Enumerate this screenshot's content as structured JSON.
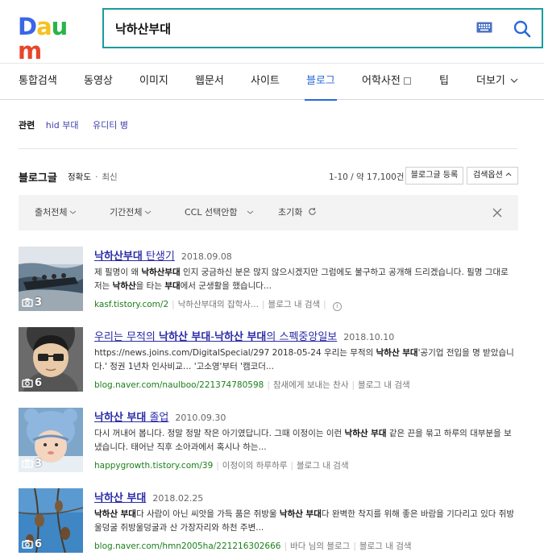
{
  "logo": {
    "text": "Daum",
    "letters": [
      "D",
      "a",
      "u",
      "m"
    ],
    "colors": [
      "#3a66e8",
      "#f5c21f",
      "#2bb34a",
      "#e8452a"
    ]
  },
  "search": {
    "query": "낙하산부대",
    "placeholder": ""
  },
  "tabs": [
    {
      "label": "통합검색"
    },
    {
      "label": "동영상"
    },
    {
      "label": "이미지"
    },
    {
      "label": "웹문서"
    },
    {
      "label": "사이트"
    },
    {
      "label": "블로그",
      "active": true
    },
    {
      "label": "어학사전"
    },
    {
      "label": "팁"
    },
    {
      "label": "더보기"
    }
  ],
  "related": {
    "label": "관련",
    "items": [
      "hid 부대",
      "유디티 병"
    ]
  },
  "blog_section": {
    "title": "블로그글",
    "sort_active": "정확도",
    "sort_other": "최신",
    "count": "1-10 / 약 17,100건",
    "register_button": "블로그글 등록",
    "options_button": "검색옵션"
  },
  "filters": [
    "출처전체",
    "기간전체",
    "CCL 선택안함",
    "초기화"
  ],
  "results": [
    {
      "title_parts": [
        {
          "t": "낙하산부대",
          "b": true
        },
        {
          "t": " 탄생기",
          "b": false
        }
      ],
      "date": "2018.09.08",
      "desc_parts": [
        {
          "t": "제 필명이 왜 ",
          "b": false
        },
        {
          "t": "낙하산부대",
          "b": true
        },
        {
          "t": " 인지 궁금하신 분은 많지 않으시겠지만 그럼에도 불구하고 공개해 드리겠습니다. 필명 그대로 저는 ",
          "b": false
        },
        {
          "t": "낙하산",
          "b": true
        },
        {
          "t": "을 타는 ",
          "b": false
        },
        {
          "t": "부대",
          "b": true
        },
        {
          "t": "에서 군생활을 했습니다...",
          "b": false
        }
      ],
      "url": "kasf.tistory.com/2",
      "source": "낙하산부대의 잡학사...",
      "action": "블로그 내 검색",
      "photo_count": "3",
      "thumb": "soldiers-raft"
    },
    {
      "title_parts": [
        {
          "t": "우리는 무적의 ",
          "b": false
        },
        {
          "t": "낙하산 부대",
          "b": true
        },
        {
          "t": "-",
          "b": false
        },
        {
          "t": "낙하산 부대",
          "b": true
        },
        {
          "t": "의 스펙중앙일보",
          "b": false
        }
      ],
      "date": "2018.10.10",
      "desc_parts": [
        {
          "t": "https://news.joins.com/DigitalSpecial/297 2018-05-24 우리는 무적의 ",
          "b": false
        },
        {
          "t": "낙하산 부대",
          "b": true
        },
        {
          "t": "'공기업 전입을 명 받았습니다.' 정권 1년차 인사비교… '고소영'부터 '캠코더...",
          "b": false
        }
      ],
      "url": "blog.naver.com/naulboo/221374780598",
      "source": "참새에게 보내는 찬사",
      "action": "블로그 내 검색",
      "photo_count": "6",
      "thumb": "avatar-glasses"
    },
    {
      "title_parts": [
        {
          "t": "낙하산 부대",
          "b": true
        },
        {
          "t": " 졸업",
          "b": false
        }
      ],
      "date": "2010.09.30",
      "desc_parts": [
        {
          "t": "다시 꺼내어 봅니다. 정말 정말 작은 아기였답니다. 그때 이정이는 이런 ",
          "b": false
        },
        {
          "t": "낙하산 부대",
          "b": true
        },
        {
          "t": " 같은 끈을 묶고 하루의 대부분을 보냈습니다. 태어난 직후 소아과에서 혹시나 하는...",
          "b": false
        }
      ],
      "url": "happygrowth.tistory.com/39",
      "source": "이정이의 하루하루",
      "action": "블로그 내 검색",
      "photo_count": "3",
      "thumb": "baby-hat"
    },
    {
      "title_parts": [
        {
          "t": "낙하산 부대",
          "b": true
        }
      ],
      "date": "2018.02.25",
      "desc_parts": [
        {
          "t": "낙하산 부대",
          "b": true
        },
        {
          "t": "다 사람이 아닌 씨앗을 가득 품은 쥐방울 ",
          "b": false
        },
        {
          "t": "낙하산 부대",
          "b": true
        },
        {
          "t": "다 완벽한 착지를 위해 좋은 바람을 기다리고 있다 쥐방울덩굴 쥐방울덩굴과 산 가장자리와 하천 주변...",
          "b": false
        }
      ],
      "url": "blog.naver.com/hmn2005ha/221216302666",
      "source": "바다 님의 블로그",
      "action": "블로그 내 검색",
      "photo_count": "6",
      "thumb": "seed-pods"
    }
  ]
}
